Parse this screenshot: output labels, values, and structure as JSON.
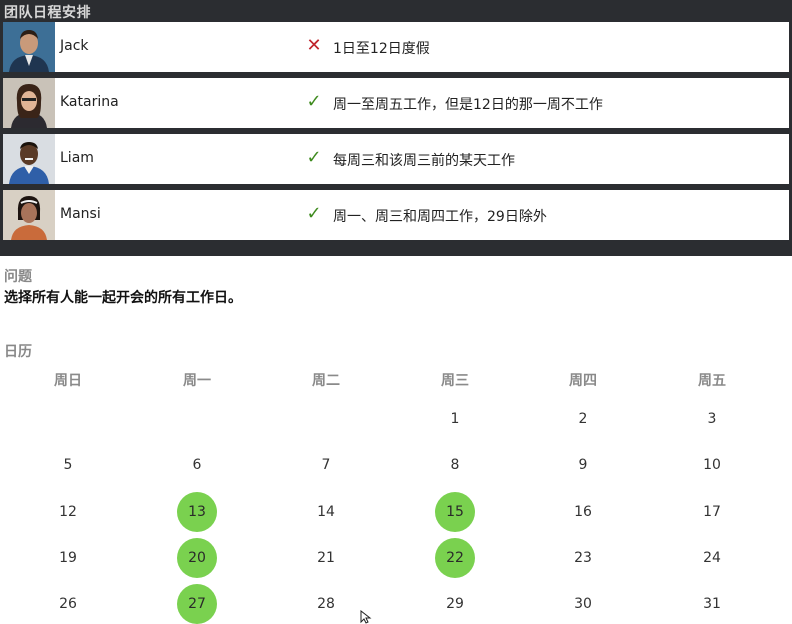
{
  "panel": {
    "title": "团队日程安排"
  },
  "people": [
    {
      "name": "Jack",
      "status": "unavailable",
      "note": "1日至12日度假"
    },
    {
      "name": "Katarina",
      "status": "available",
      "note": "周一至周五工作，但是12日的那一周不工作"
    },
    {
      "name": "Liam",
      "status": "available",
      "note": "每周三和该周三前的某天工作"
    },
    {
      "name": "Mansi",
      "status": "available",
      "note": "周一、周三和周四工作，29日除外"
    }
  ],
  "question": {
    "label": "问题",
    "text": "选择所有人能一起开会的所有工作日。"
  },
  "calendar": {
    "label": "日历",
    "weekdays": [
      "周日",
      "周一",
      "周二",
      "周三",
      "周四",
      "周五"
    ],
    "weeks": [
      [
        "",
        "",
        "",
        "1",
        "2",
        "3"
      ],
      [
        "5",
        "6",
        "7",
        "8",
        "9",
        "10"
      ],
      [
        "12",
        "13",
        "14",
        "15",
        "16",
        "17"
      ],
      [
        "19",
        "20",
        "21",
        "22",
        "23",
        "24"
      ],
      [
        "26",
        "27",
        "28",
        "29",
        "30",
        "31"
      ]
    ],
    "selected": [
      "13",
      "15",
      "20",
      "22",
      "27"
    ]
  },
  "colors": {
    "selected": "#7ad14f",
    "panel_bg": "#2b2d31",
    "cross": "#c0232b",
    "check": "#3f8b1f"
  }
}
